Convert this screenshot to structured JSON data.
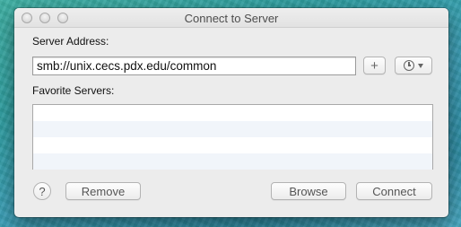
{
  "window": {
    "title": "Connect to Server"
  },
  "form": {
    "server_address_label": "Server Address:",
    "server_address_value": "smb://unix.cecs.pdx.edu/common",
    "add_favorite_label": "+",
    "recent_servers_icon": "clock-icon",
    "favorites_label": "Favorite Servers:",
    "favorites": []
  },
  "buttons": {
    "help_label": "?",
    "remove_label": "Remove",
    "browse_label": "Browse",
    "connect_label": "Connect"
  }
}
